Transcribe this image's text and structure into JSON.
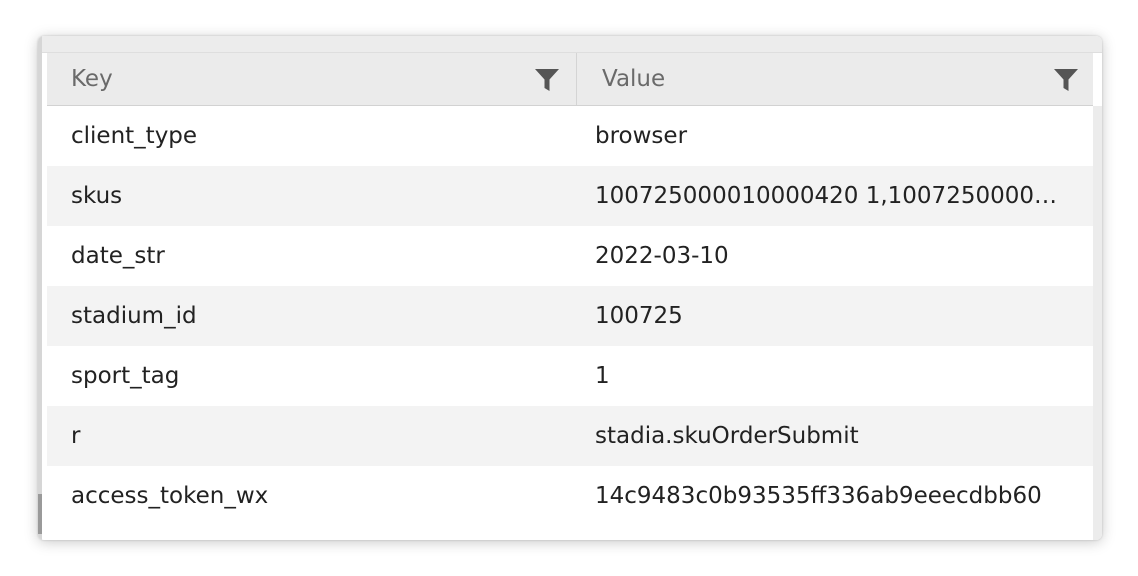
{
  "table": {
    "headers": {
      "key": "Key",
      "value": "Value"
    },
    "rows": [
      {
        "key": "client_type",
        "value": "browser"
      },
      {
        "key": "skus",
        "value": "100725000010000420 1,1007250000100..."
      },
      {
        "key": "date_str",
        "value": "2022-03-10"
      },
      {
        "key": "stadium_id",
        "value": "100725"
      },
      {
        "key": "sport_tag",
        "value": "1"
      },
      {
        "key": "r",
        "value": "stadia.skuOrderSubmit"
      },
      {
        "key": "access_token_wx",
        "value": "14c9483c0b93535ff336ab9eeecdbb60"
      }
    ]
  },
  "icons": {
    "key_filter": "filter-icon",
    "value_filter": "filter-icon"
  },
  "colors": {
    "header_bg": "#ebebeb",
    "row_alt_bg": "#f3f3f3",
    "text": "#222222",
    "header_text": "#6a6a6a",
    "icon": "#555555"
  }
}
